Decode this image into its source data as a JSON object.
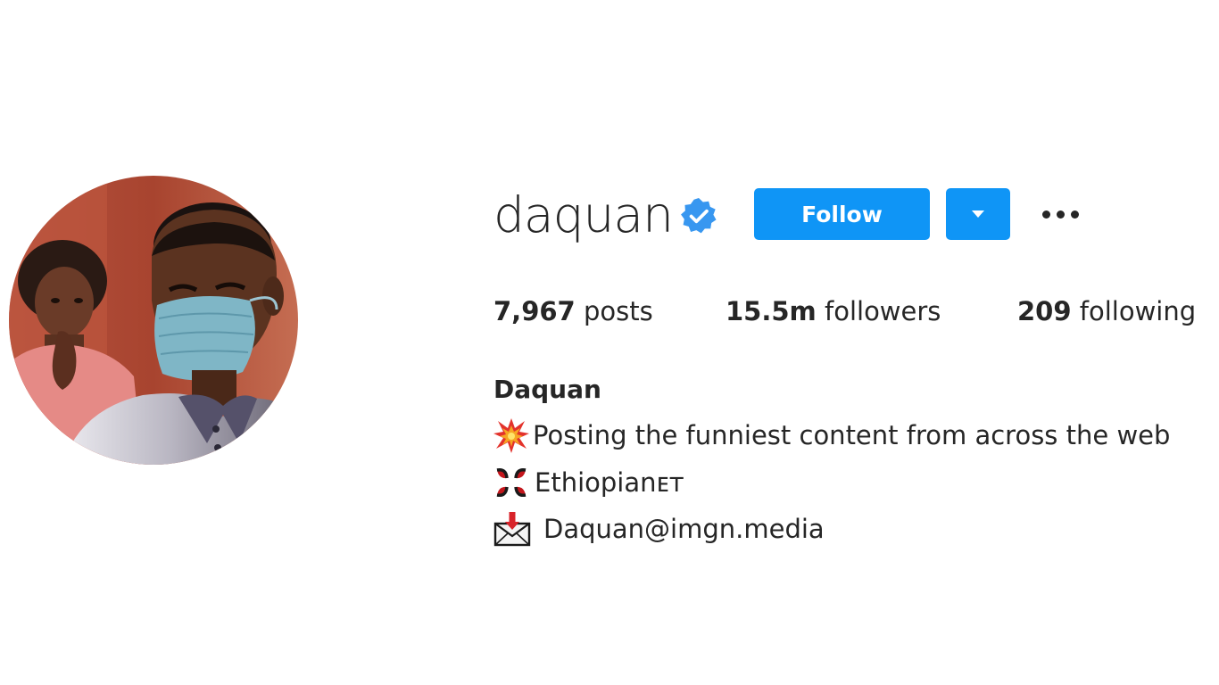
{
  "profile": {
    "username": "daquan",
    "verified": true,
    "verified_icon": "verified-badge-icon",
    "follow_label": "Follow",
    "dropdown_icon": "caret-down-icon",
    "more_icon": "more-dots-icon",
    "accent_color": "#0f95f6"
  },
  "stats": {
    "posts_count": "7,967",
    "posts_label": "posts",
    "followers_count": "15.5m",
    "followers_label": "followers",
    "following_count": "209",
    "following_label": "following"
  },
  "bio": {
    "full_name": "Daquan",
    "lines": [
      {
        "icon": "collision-emoji-icon",
        "text": "Posting the funniest content from across the web"
      },
      {
        "icon": "anger-symbol-emoji-icon",
        "text": "Ethiopianᴇᴛ"
      },
      {
        "icon": "envelope-arrow-emoji-icon",
        "text": "Daquan@imgn.media"
      }
    ]
  },
  "avatar": {
    "icon": "profile-photo"
  }
}
